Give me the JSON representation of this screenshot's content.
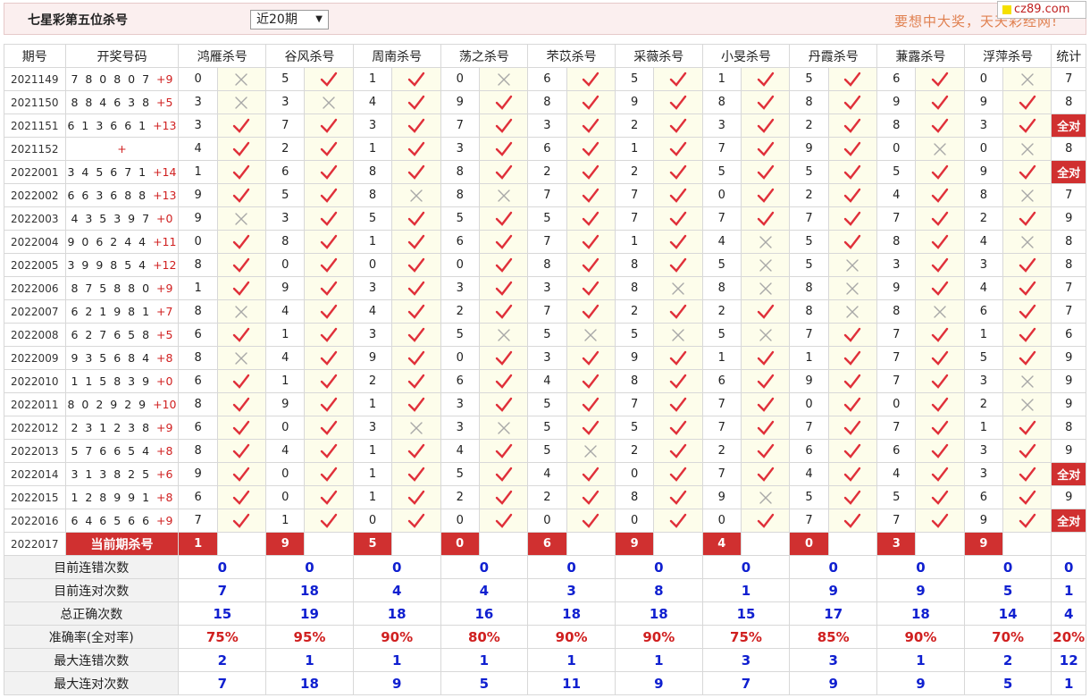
{
  "header": {
    "title": "七星彩第五位杀号",
    "period_select": "近20期",
    "slogan": "要想中大奖，天天彩经网!",
    "logo_text": "cz89.com"
  },
  "table": {
    "col_period": "期号",
    "col_draw": "开奖号码",
    "col_stat": "统计",
    "experts": [
      "鸿雁杀号",
      "谷风杀号",
      "周南杀号",
      "荡之杀号",
      "芣苡杀号",
      "采薇杀号",
      "小旻杀号",
      "丹霞杀号",
      "蒹露杀号",
      "浮萍杀号"
    ],
    "rows": [
      {
        "period": "2021149",
        "digits": "7 8 0 8 0 7",
        "plus": "+9",
        "kills": [
          "0",
          "5",
          "1",
          "0",
          "6",
          "5",
          "1",
          "5",
          "6",
          "0"
        ],
        "marks": [
          "x",
          "v",
          "v",
          "x",
          "v",
          "v",
          "v",
          "v",
          "v",
          "x"
        ],
        "stat": "7"
      },
      {
        "period": "2021150",
        "digits": "8 8 4 6 3 8",
        "plus": "+5",
        "kills": [
          "3",
          "3",
          "4",
          "9",
          "8",
          "9",
          "8",
          "8",
          "9",
          "9"
        ],
        "marks": [
          "x",
          "x",
          "v",
          "v",
          "v",
          "v",
          "v",
          "v",
          "v",
          "v"
        ],
        "stat": "8"
      },
      {
        "period": "2021151",
        "digits": "6 1 3 6 6 1",
        "plus": "+13",
        "kills": [
          "3",
          "7",
          "3",
          "7",
          "3",
          "2",
          "3",
          "2",
          "8",
          "3"
        ],
        "marks": [
          "v",
          "v",
          "v",
          "v",
          "v",
          "v",
          "v",
          "v",
          "v",
          "v"
        ],
        "stat": "全对"
      },
      {
        "period": "2021152",
        "digits": "",
        "plus": "+",
        "kills": [
          "4",
          "2",
          "1",
          "3",
          "6",
          "1",
          "7",
          "9",
          "0",
          "0"
        ],
        "marks": [
          "v",
          "v",
          "v",
          "v",
          "v",
          "v",
          "v",
          "v",
          "x",
          "x"
        ],
        "stat": "8"
      },
      {
        "period": "2022001",
        "digits": "3 4 5 6 7 1",
        "plus": "+14",
        "kills": [
          "1",
          "6",
          "8",
          "8",
          "2",
          "2",
          "5",
          "5",
          "5",
          "9"
        ],
        "marks": [
          "v",
          "v",
          "v",
          "v",
          "v",
          "v",
          "v",
          "v",
          "v",
          "v"
        ],
        "stat": "全对"
      },
      {
        "period": "2022002",
        "digits": "6 6 3 6 8 8",
        "plus": "+13",
        "kills": [
          "9",
          "5",
          "8",
          "8",
          "7",
          "7",
          "0",
          "2",
          "4",
          "8"
        ],
        "marks": [
          "v",
          "v",
          "x",
          "x",
          "v",
          "v",
          "v",
          "v",
          "v",
          "x"
        ],
        "stat": "7"
      },
      {
        "period": "2022003",
        "digits": "4 3 5 3 9 7",
        "plus": "+0",
        "kills": [
          "9",
          "3",
          "5",
          "5",
          "5",
          "7",
          "7",
          "7",
          "7",
          "2"
        ],
        "marks": [
          "x",
          "v",
          "v",
          "v",
          "v",
          "v",
          "v",
          "v",
          "v",
          "v"
        ],
        "stat": "9"
      },
      {
        "period": "2022004",
        "digits": "9 0 6 2 4 4",
        "plus": "+11",
        "kills": [
          "0",
          "8",
          "1",
          "6",
          "7",
          "1",
          "4",
          "5",
          "8",
          "4"
        ],
        "marks": [
          "v",
          "v",
          "v",
          "v",
          "v",
          "v",
          "x",
          "v",
          "v",
          "x"
        ],
        "stat": "8"
      },
      {
        "period": "2022005",
        "digits": "3 9 9 8 5 4",
        "plus": "+12",
        "kills": [
          "8",
          "0",
          "0",
          "0",
          "8",
          "8",
          "5",
          "5",
          "3",
          "3"
        ],
        "marks": [
          "v",
          "v",
          "v",
          "v",
          "v",
          "v",
          "x",
          "x",
          "v",
          "v"
        ],
        "stat": "8"
      },
      {
        "period": "2022006",
        "digits": "8 7 5 8 8 0",
        "plus": "+9",
        "kills": [
          "1",
          "9",
          "3",
          "3",
          "3",
          "8",
          "8",
          "8",
          "9",
          "4"
        ],
        "marks": [
          "v",
          "v",
          "v",
          "v",
          "v",
          "x",
          "x",
          "x",
          "v",
          "v"
        ],
        "stat": "7"
      },
      {
        "period": "2022007",
        "digits": "6 2 1 9 8 1",
        "plus": "+7",
        "kills": [
          "8",
          "4",
          "4",
          "2",
          "7",
          "2",
          "2",
          "8",
          "8",
          "6"
        ],
        "marks": [
          "x",
          "v",
          "v",
          "v",
          "v",
          "v",
          "v",
          "x",
          "x",
          "v"
        ],
        "stat": "7"
      },
      {
        "period": "2022008",
        "digits": "6 2 7 6 5 8",
        "plus": "+5",
        "kills": [
          "6",
          "1",
          "3",
          "5",
          "5",
          "5",
          "5",
          "7",
          "7",
          "1"
        ],
        "marks": [
          "v",
          "v",
          "v",
          "x",
          "x",
          "x",
          "x",
          "v",
          "v",
          "v"
        ],
        "stat": "6"
      },
      {
        "period": "2022009",
        "digits": "9 3 5 6 8 4",
        "plus": "+8",
        "kills": [
          "8",
          "4",
          "9",
          "0",
          "3",
          "9",
          "1",
          "1",
          "7",
          "5"
        ],
        "marks": [
          "x",
          "v",
          "v",
          "v",
          "v",
          "v",
          "v",
          "v",
          "v",
          "v"
        ],
        "stat": "9"
      },
      {
        "period": "2022010",
        "digits": "1 1 5 8 3 9",
        "plus": "+0",
        "kills": [
          "6",
          "1",
          "2",
          "6",
          "4",
          "8",
          "6",
          "9",
          "7",
          "3"
        ],
        "marks": [
          "v",
          "v",
          "v",
          "v",
          "v",
          "v",
          "v",
          "v",
          "v",
          "x"
        ],
        "stat": "9"
      },
      {
        "period": "2022011",
        "digits": "8 0 2 9 2 9",
        "plus": "+10",
        "kills": [
          "8",
          "9",
          "1",
          "3",
          "5",
          "7",
          "7",
          "0",
          "0",
          "2"
        ],
        "marks": [
          "v",
          "v",
          "v",
          "v",
          "v",
          "v",
          "v",
          "v",
          "v",
          "x"
        ],
        "stat": "9"
      },
      {
        "period": "2022012",
        "digits": "2 3 1 2 3 8",
        "plus": "+9",
        "kills": [
          "6",
          "0",
          "3",
          "3",
          "5",
          "5",
          "7",
          "7",
          "7",
          "1"
        ],
        "marks": [
          "v",
          "v",
          "x",
          "x",
          "v",
          "v",
          "v",
          "v",
          "v",
          "v"
        ],
        "stat": "8"
      },
      {
        "period": "2022013",
        "digits": "5 7 6 6 5 4",
        "plus": "+8",
        "kills": [
          "8",
          "4",
          "1",
          "4",
          "5",
          "2",
          "2",
          "6",
          "6",
          "3"
        ],
        "marks": [
          "v",
          "v",
          "v",
          "v",
          "x",
          "v",
          "v",
          "v",
          "v",
          "v"
        ],
        "stat": "9"
      },
      {
        "period": "2022014",
        "digits": "3 1 3 8 2 5",
        "plus": "+6",
        "kills": [
          "9",
          "0",
          "1",
          "5",
          "4",
          "0",
          "7",
          "4",
          "4",
          "3"
        ],
        "marks": [
          "v",
          "v",
          "v",
          "v",
          "v",
          "v",
          "v",
          "v",
          "v",
          "v"
        ],
        "stat": "全对"
      },
      {
        "period": "2022015",
        "digits": "1 2 8 9 9 1",
        "plus": "+8",
        "kills": [
          "6",
          "0",
          "1",
          "2",
          "2",
          "8",
          "9",
          "5",
          "5",
          "6"
        ],
        "marks": [
          "v",
          "v",
          "v",
          "v",
          "v",
          "v",
          "x",
          "v",
          "v",
          "v"
        ],
        "stat": "9"
      },
      {
        "period": "2022016",
        "digits": "6 4 6 5 6 6",
        "plus": "+9",
        "kills": [
          "7",
          "1",
          "0",
          "0",
          "0",
          "0",
          "0",
          "7",
          "7",
          "9"
        ],
        "marks": [
          "v",
          "v",
          "v",
          "v",
          "v",
          "v",
          "v",
          "v",
          "v",
          "v"
        ],
        "stat": "全对"
      }
    ],
    "current": {
      "period": "2022017",
      "label": "当前期杀号",
      "kills": [
        "1",
        "9",
        "5",
        "0",
        "6",
        "9",
        "4",
        "0",
        "3",
        "9"
      ]
    },
    "summary": [
      {
        "label": "目前连错次数",
        "values": [
          "0",
          "0",
          "0",
          "0",
          "0",
          "0",
          "0",
          "0",
          "0",
          "0"
        ],
        "stat": "0",
        "color": "blue"
      },
      {
        "label": "目前连对次数",
        "values": [
          "7",
          "18",
          "4",
          "4",
          "3",
          "8",
          "1",
          "9",
          "9",
          "5"
        ],
        "stat": "1",
        "color": "blue"
      },
      {
        "label": "总正确次数",
        "values": [
          "15",
          "19",
          "18",
          "16",
          "18",
          "18",
          "15",
          "17",
          "18",
          "14"
        ],
        "stat": "4",
        "color": "blue"
      },
      {
        "label": "准确率(全对率)",
        "values": [
          "75%",
          "95%",
          "90%",
          "80%",
          "90%",
          "90%",
          "75%",
          "85%",
          "90%",
          "70%"
        ],
        "stat": "20%",
        "color": "red"
      },
      {
        "label": "最大连错次数",
        "values": [
          "2",
          "1",
          "1",
          "1",
          "1",
          "1",
          "3",
          "3",
          "1",
          "2"
        ],
        "stat": "12",
        "color": "blue"
      },
      {
        "label": "最大连对次数",
        "values": [
          "7",
          "18",
          "9",
          "5",
          "11",
          "9",
          "7",
          "9",
          "9",
          "5"
        ],
        "stat": "1",
        "color": "blue"
      }
    ]
  },
  "colors": {
    "check": "#e0303a",
    "cross": "#a8a8a8",
    "highlight": "#d03030",
    "blue": "#1020d0"
  }
}
